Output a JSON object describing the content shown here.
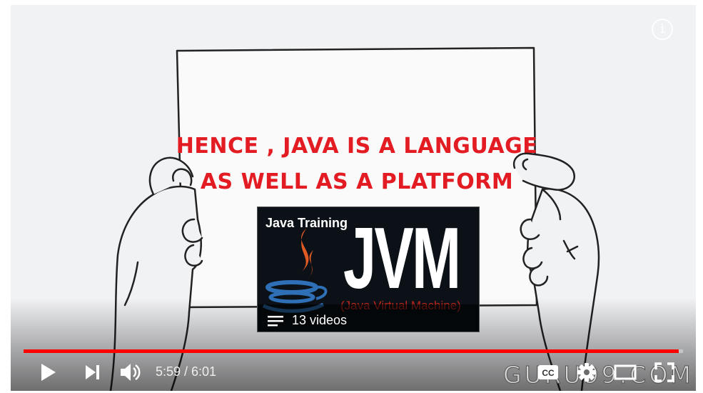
{
  "video": {
    "slogan_line1": "HENCE , JAVA IS A LANGUAGE",
    "slogan_line2": "AS WELL AS A PLATFORM",
    "info_label": "i"
  },
  "card": {
    "title": "Java Training",
    "jvm_text": "JVM",
    "subtitle": "(Java Virtual Machine)",
    "count": "13 videos"
  },
  "controls": {
    "time": "5:59 / 6:01",
    "progress": 0.994,
    "watermark": "GURU99.COM"
  },
  "colors": {
    "progress": "#ff0000",
    "slogan": "#e31b23"
  },
  "icons": [
    "play-icon",
    "next-icon",
    "volume-icon",
    "captions-icon",
    "settings-icon",
    "theater-icon",
    "fullscreen-icon",
    "info-icon",
    "playlist-icon",
    "java-logo-icon"
  ]
}
